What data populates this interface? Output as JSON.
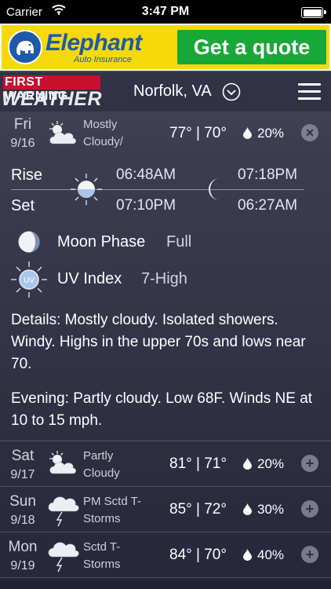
{
  "status_bar": {
    "carrier": "Carrier",
    "time": "3:47 PM"
  },
  "ad": {
    "brand": "Elephant",
    "subtitle": "Auto Insurance",
    "cta": "Get a quote"
  },
  "header": {
    "logo_line1": "FIRST WARNING",
    "logo_line2": "WEATHER",
    "location": "Norfolk, VA"
  },
  "today": {
    "day": "Fri",
    "date": "9/16",
    "condition_line1": "Mostly",
    "condition_line2": "Cloudy/",
    "temps": "77° | 70°",
    "precip": "20%",
    "icon": "partly-cloudy-icon"
  },
  "sun_moon": {
    "rise_label": "Rise",
    "set_label": "Set",
    "sunrise": "06:48AM",
    "sunset": "07:10PM",
    "moonrise": "07:18PM",
    "moonset": "06:27AM"
  },
  "moon_phase": {
    "label": "Moon Phase",
    "value": "Full"
  },
  "uv_index": {
    "label": "UV Index",
    "value": "7-High",
    "icon_text": "UV"
  },
  "details": "Details: Mostly cloudy. Isolated showers. Windy. Highs in the upper 70s and lows near 70.",
  "evening": "Evening: Partly cloudy. Low 68F. Winds NE at 10 to 15 mph.",
  "forecast": [
    {
      "day": "Sat",
      "date": "9/17",
      "condition_line1": "Partly",
      "condition_line2": "Cloudy",
      "temps": "81° | 71°",
      "precip": "20%",
      "icon": "partly-cloudy-icon"
    },
    {
      "day": "Sun",
      "date": "9/18",
      "condition_line1": "PM Sctd T-",
      "condition_line2": "Storms",
      "temps": "85° | 72°",
      "precip": "30%",
      "icon": "thunderstorm-icon"
    },
    {
      "day": "Mon",
      "date": "9/19",
      "condition_line1": "Sctd T-",
      "condition_line2": "Storms",
      "temps": "84° | 70°",
      "precip": "40%",
      "icon": "thunderstorm-icon"
    }
  ],
  "colors": {
    "ad_yellow": "#f5d90b",
    "ad_blue": "#1e5aa8",
    "ad_green": "#17a838",
    "logo_red": "#c8102e",
    "sun_blue": "#a9c6ea"
  }
}
